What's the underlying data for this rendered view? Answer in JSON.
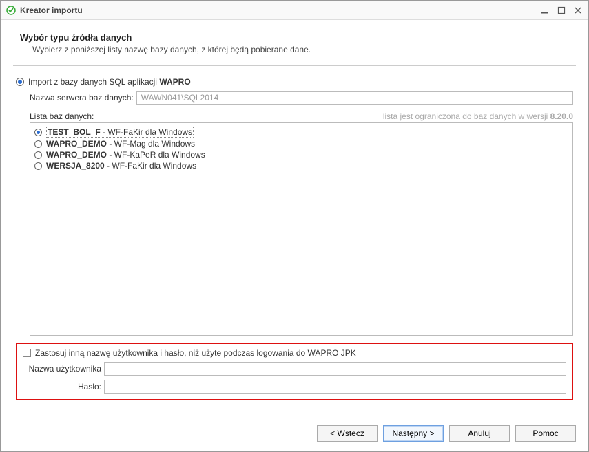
{
  "window": {
    "title": "Kreator importu"
  },
  "header": {
    "title": "Wybór typu źródła danych",
    "subtitle": "Wybierz z poniższej listy nazwę bazy danych, z której będą pobierane dane."
  },
  "source": {
    "radio_label_prefix": "Import z bazy danych SQL aplikacji ",
    "radio_label_bold": "WAPRO",
    "server_label": "Nazwa serwera baz danych:",
    "server_value": "WAWN041\\SQL2014"
  },
  "dblist": {
    "label": "Lista baz danych:",
    "limit_prefix": "lista jest ograniczona do baz danych w wersji ",
    "limit_version": "8.20.0",
    "items": [
      {
        "name": "TEST_BOL_F",
        "desc": " - WF-FaKir dla Windows",
        "selected": true
      },
      {
        "name": "WAPRO_DEMO",
        "desc": " - WF-Mag dla Windows",
        "selected": false
      },
      {
        "name": "WAPRO_DEMO",
        "desc": " - WF-KaPeR dla Windows",
        "selected": false
      },
      {
        "name": "WERSJA_8200",
        "desc": " - WF-FaKir dla Windows",
        "selected": false
      }
    ]
  },
  "credentials": {
    "checkbox_label": "Zastosuj inną nazwę użytkownika i hasło, niż użyte podczas logowania do WAPRO JPK",
    "username_label": "Nazwa użytkownika",
    "username_value": "",
    "password_label": "Hasło:",
    "password_value": ""
  },
  "footer": {
    "back": "<  Wstecz",
    "next": "Następny >",
    "cancel": "Anuluj",
    "help": "Pomoc"
  }
}
